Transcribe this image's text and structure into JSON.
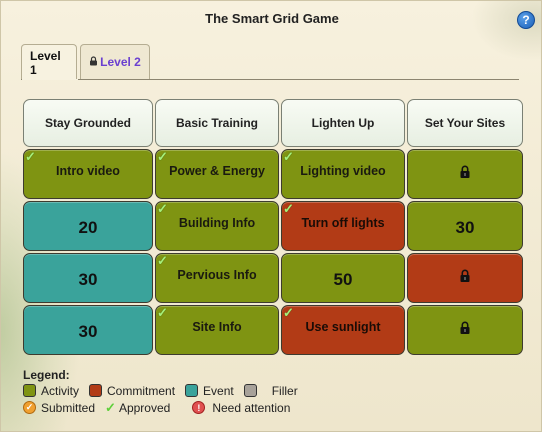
{
  "window": {
    "title": "The Smart Grid Game",
    "help_icon": "help-icon",
    "help_glyph": "?"
  },
  "tabs": [
    {
      "label": "Level 1",
      "active": true,
      "locked": false
    },
    {
      "label": "Level 2",
      "active": false,
      "locked": true
    }
  ],
  "columns": [
    "Stay Grounded",
    "Basic Training",
    "Lighten Up",
    "Set Your Sites"
  ],
  "grid": [
    [
      {
        "type": "activity",
        "label": "Intro video",
        "approved": true
      },
      {
        "type": "activity",
        "label": "Power & Energy",
        "approved": true
      },
      {
        "type": "activity",
        "label": "Lighting video",
        "approved": true
      },
      {
        "type": "activity",
        "locked": true
      }
    ],
    [
      {
        "type": "event",
        "value": "20"
      },
      {
        "type": "activity",
        "label": "Building Info",
        "approved": true
      },
      {
        "type": "commitment",
        "label": "Turn off lights",
        "approved": true
      },
      {
        "type": "activity",
        "value": "30"
      }
    ],
    [
      {
        "type": "event",
        "value": "30"
      },
      {
        "type": "activity",
        "label": "Pervious Info",
        "approved": true
      },
      {
        "type": "activity",
        "value": "50"
      },
      {
        "type": "commitment",
        "locked": true
      }
    ],
    [
      {
        "type": "event",
        "value": "30"
      },
      {
        "type": "activity",
        "label": "Site Info",
        "approved": true
      },
      {
        "type": "commitment",
        "label": "Use sunlight",
        "approved": true
      },
      {
        "type": "activity",
        "locked": true
      }
    ]
  ],
  "legend": {
    "title": "Legend:",
    "types": [
      {
        "label": "Activity",
        "color": "#7f9412"
      },
      {
        "label": "Commitment",
        "color": "#b23b16"
      },
      {
        "label": "Event",
        "color": "#3aa39b"
      },
      {
        "label": "Filler",
        "color": "#a8a29a"
      }
    ],
    "statuses": [
      {
        "label": "Submitted",
        "icon": "submitted-icon"
      },
      {
        "label": "Approved",
        "icon": "approved-check-icon"
      },
      {
        "label": "Need  attention",
        "icon": "need-attention-icon"
      }
    ]
  },
  "colors": {
    "activity": "#7f9412",
    "commitment": "#b23b16",
    "event": "#3aa39b",
    "filler": "#a8a29a",
    "level2_tab_text": "#6a3fd0"
  }
}
